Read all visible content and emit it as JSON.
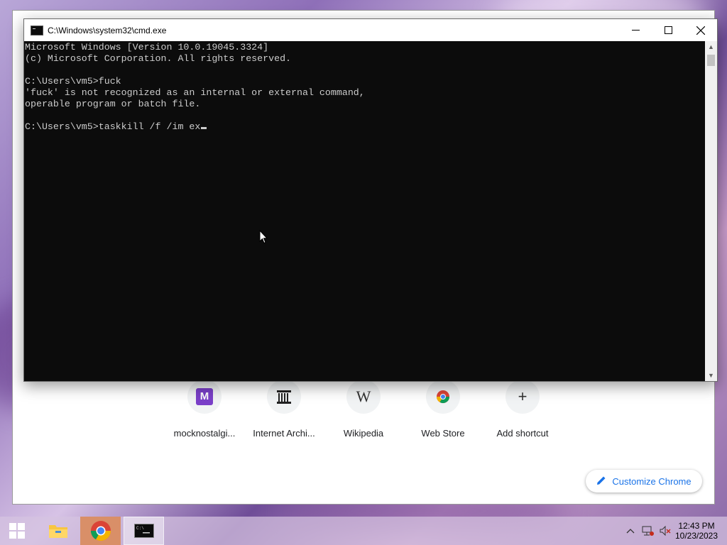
{
  "cmd": {
    "title": "C:\\Windows\\system32\\cmd.exe",
    "lines": [
      "Microsoft Windows [Version 10.0.19045.3324]",
      "(c) Microsoft Corporation. All rights reserved.",
      "",
      "C:\\Users\\vm5>fuck",
      "'fuck' is not recognized as an internal or external command,",
      "operable program or batch file.",
      "",
      "C:\\Users\\vm5>taskkill /f /im ex"
    ],
    "controls": {
      "minimize": "—",
      "maximize": "☐",
      "close": "✕"
    }
  },
  "chrome": {
    "shortcuts": [
      {
        "label": "mocknostalgi...",
        "icon": "mocknostalgia-icon",
        "glyph": "M"
      },
      {
        "label": "Internet Archi...",
        "icon": "internet-archive-icon",
        "glyph": "🏛"
      },
      {
        "label": "Wikipedia",
        "icon": "wikipedia-icon",
        "glyph": "W"
      },
      {
        "label": "Web Store",
        "icon": "web-store-icon",
        "glyph": "◉"
      },
      {
        "label": "Add shortcut",
        "icon": "plus-icon",
        "glyph": "+"
      }
    ],
    "customize_label": "Customize Chrome",
    "accent": "#1a73e8"
  },
  "taskbar": {
    "time": "12:43 PM",
    "date": "10/23/2023",
    "items": [
      "start-button",
      "file-explorer",
      "chrome",
      "cmd"
    ]
  }
}
